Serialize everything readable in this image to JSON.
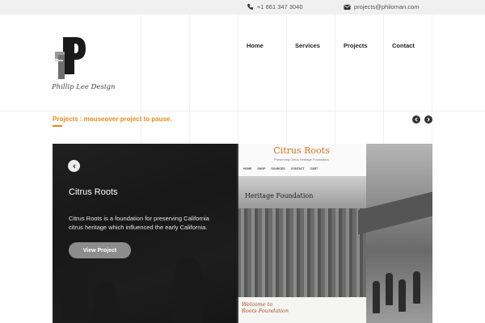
{
  "topbar": {
    "phone": "+1 661 347 3040",
    "email": "projects@philoman.com",
    "phone_icon": "phone-icon",
    "email_icon": "envelope-icon"
  },
  "brand": {
    "caption": "Phillip Lee Design",
    "logo_icon": "pl-monogram-logo"
  },
  "nav": {
    "items": [
      {
        "label": "Home"
      },
      {
        "label": "Services"
      },
      {
        "label": "Projects"
      },
      {
        "label": "Contact"
      }
    ]
  },
  "projects": {
    "heading": "Projects : mouseover project to pause.",
    "prev_icon": "chevron-left-icon",
    "next_icon": "chevron-right-icon"
  },
  "featured": {
    "title": "Citrus Roots",
    "description": "Citrus Roots is a foundation for preserving California citrus heritage which influenced the early California.",
    "button": "View Project",
    "back_icon": "chevron-left-icon",
    "screenshot": {
      "brand": "Citrus Roots",
      "tagline": "Preserving Citrus Heritage Foundation",
      "menu": [
        "HOME",
        "SHOP",
        "SOURCES",
        "CONTACT",
        "CART"
      ],
      "hero_title": "Heritage Foundation",
      "welcome": "Welcome to",
      "welcome_2": "Roots Foundation"
    }
  },
  "colors": {
    "accent": "#e8891c",
    "topbar": "#f0f0f0",
    "button": "#8c8c8c"
  }
}
